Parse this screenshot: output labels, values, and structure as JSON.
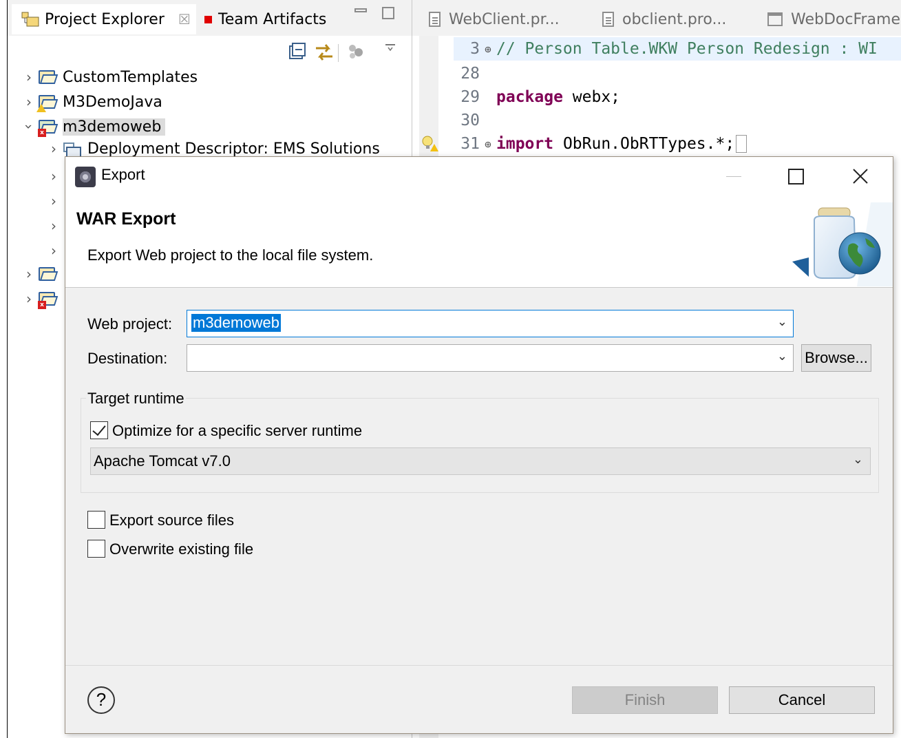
{
  "explorer": {
    "tabs": [
      {
        "label": "Project Explorer",
        "close": "☒"
      },
      {
        "label": "Team Artifacts"
      }
    ],
    "tree": [
      {
        "label": "CustomTemplates",
        "expanded": false
      },
      {
        "label": "M3DemoJava",
        "expanded": false
      },
      {
        "label": "m3demoweb",
        "expanded": true
      },
      {
        "label": "Deployment Descriptor: EMS Solutions",
        "expanded": false
      }
    ]
  },
  "editor": {
    "tabs": [
      {
        "label": "WebClient.pr..."
      },
      {
        "label": "obclient.pro..."
      },
      {
        "label": "WebDocFrame."
      }
    ],
    "lines": [
      {
        "num": "3",
        "text": "// Person Table.WKW Person Redesign : WI"
      },
      {
        "num": "28",
        "text": ""
      },
      {
        "num": "29",
        "keyword": "package",
        "text": " webx;"
      },
      {
        "num": "30",
        "text": ""
      },
      {
        "num": "31",
        "keyword": "import",
        "text": " ObRun.ObRTTypes.*;"
      }
    ]
  },
  "dialog": {
    "title": "Export",
    "banner_title": "WAR Export",
    "banner_desc": "Export Web project to the local file system.",
    "web_project_label": "Web project:",
    "web_project_value": "m3demoweb",
    "destination_label": "Destination:",
    "destination_value": "",
    "browse_label": "Browse...",
    "target_runtime_label": "Target runtime",
    "optimize_label": "Optimize for a specific server runtime",
    "optimize_checked": true,
    "runtime_value": "Apache Tomcat v7.0",
    "export_source_label": "Export source files",
    "export_source_checked": false,
    "overwrite_label": "Overwrite existing file",
    "overwrite_checked": false,
    "help_label": "?",
    "finish_label": "Finish",
    "cancel_label": "Cancel"
  },
  "colors": {
    "accent": "#0078d7",
    "comment": "#3f7f5f",
    "keyword": "#7f0055",
    "team_artifacts_marker": "#e00000"
  }
}
